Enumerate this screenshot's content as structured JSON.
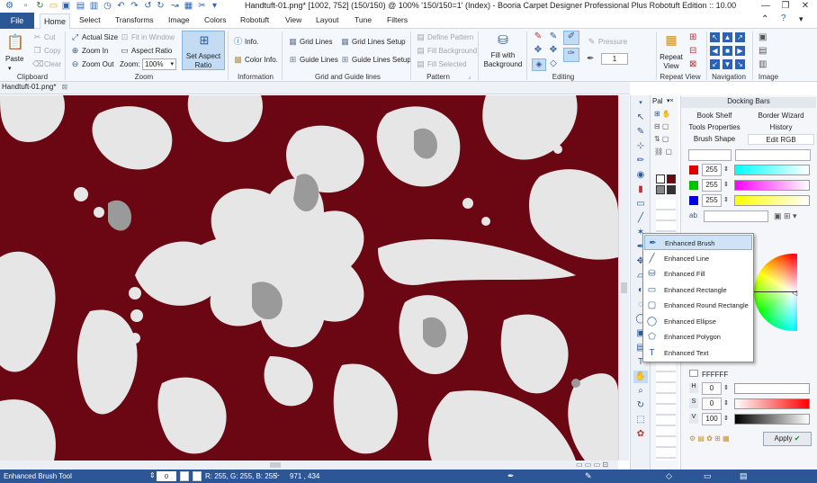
{
  "window": {
    "title": "Handtuft-01.png* [1002, 752] (150/150) @ 100% '150/150=1' (Index) - Booria Carpet Designer Professional Plus Robotuft Edition :: 10.00",
    "minimize": "—",
    "restore": "❐",
    "close": "✕"
  },
  "quick_access": [
    "app-logo-icon",
    "new-file-icon",
    "refresh-icon",
    "open-folder-icon",
    "save-icon",
    "undo-icon",
    "redo-icon",
    "undo-dropdown-icon"
  ],
  "menu": {
    "file": "File",
    "tabs": [
      "Home",
      "Select",
      "Transforms",
      "Image",
      "Colors",
      "Robotuft",
      "View",
      "Layout",
      "Tune",
      "Filters"
    ]
  },
  "ribbon": {
    "clipboard": {
      "paste": "Paste",
      "cut": "Cut",
      "copy": "Copy",
      "clear": "Clear",
      "label": "Clipboard"
    },
    "zoom": {
      "actual_size": "Actual Size",
      "fit_in_window": "Fit in Window",
      "zoom_in": "Zoom In",
      "aspect_ratio": "Aspect Ratio",
      "zoom_out": "Zoom Out",
      "zoom_label": "Zoom:",
      "zoom_value": "100%",
      "label": "Zoom"
    },
    "set_aspect": {
      "line1": "Set Aspect",
      "line2": "Ratio"
    },
    "information": {
      "info": "Info.",
      "color_info": "Color Info.",
      "label": "Information"
    },
    "grid": {
      "grid_lines": "Grid Lines",
      "grid_lines_setup": "Grid Lines Setup",
      "guide_lines": "Guide Lines",
      "guide_lines_setup": "Guide Lines Setup",
      "label": "Grid and Guide lines"
    },
    "pattern": {
      "define_pattern": "Define Pattern",
      "fill_background": "Fill Background",
      "fill_selected": "Fill Selected",
      "label": "Pattern"
    },
    "fill": {
      "line1": "Fill with",
      "line2": "Background"
    },
    "editing": {
      "pressure": "Pressure",
      "pressure_value": "1",
      "label": "Editing"
    },
    "repeat": {
      "line1": "Repeat",
      "line2": "View",
      "label": "Repeat View"
    },
    "navigation": {
      "label": "Navigation"
    },
    "image": {
      "label": "Image"
    }
  },
  "document": {
    "tab": "Handtuft-01.png*"
  },
  "colors": {
    "background": "#6b0712",
    "motif": "#e6e6e6",
    "accent": "#9a9a9a",
    "ribbon": "#f4f7fb",
    "status": "#2b5797"
  },
  "palette": {
    "title": "Pal"
  },
  "dock": {
    "title": "Docking Bars",
    "tabs_row1": [
      "Book Shelf",
      "Border Wizard"
    ],
    "tabs_row2": [
      "Tools Properties",
      "History"
    ],
    "tabs_row3": [
      "Brush Shape",
      "Edit RGB"
    ],
    "r": "255",
    "g": "255",
    "b": "255",
    "hex": "FFFFFF",
    "h": "0",
    "s": "0",
    "v": "100",
    "h_label": "H",
    "s_label": "S",
    "v_label": "V",
    "apply": "Apply"
  },
  "popup": {
    "items": [
      "Enhanced Brush",
      "Enhanced Line",
      "Enhanced Fill",
      "Enhanced Rectangle",
      "Enhanced Round Rectangle",
      "Enhanced Ellipse",
      "Enhanced Polygon",
      "Enhanced Text"
    ],
    "icons": [
      "brush-icon",
      "line-icon",
      "fill-icon",
      "rectangle-icon",
      "round-rectangle-icon",
      "ellipse-icon",
      "polygon-icon",
      "text-icon"
    ]
  },
  "status": {
    "tool": "Enhanced Brush Tool",
    "val1": "0",
    "val2": "0",
    "rgb": "R: 255, G: 255, B: 255",
    "coords": "971 , 434"
  }
}
